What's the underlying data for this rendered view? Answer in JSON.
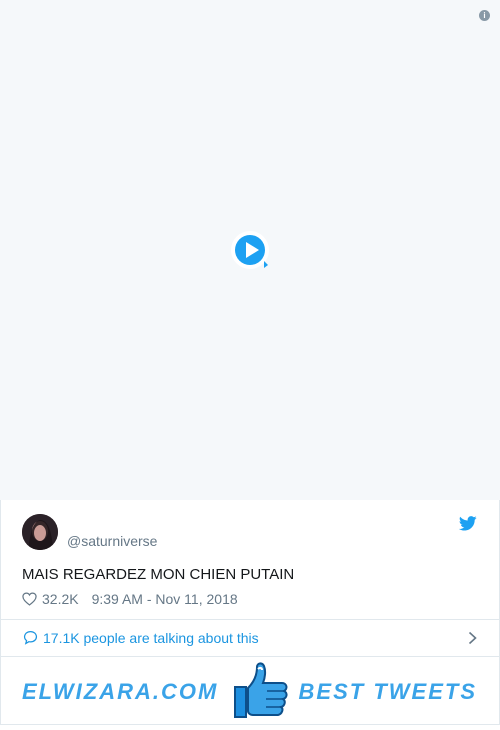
{
  "tweet": {
    "handle": "@saturniverse",
    "text": "MAIS REGARDEZ MON CHIEN PUTAIN",
    "likes": "32.2K",
    "timestamp": "9:39 AM - Nov 11, 2018",
    "talking": "17.1K people are talking about this"
  },
  "banner": {
    "brand": "ELWIZARA.COM",
    "tagline": "BEST TWEETS"
  },
  "icons": {
    "info": "info-icon",
    "play": "play-icon",
    "bird": "twitter-bird-icon",
    "heart": "heart-icon",
    "bubble": "speech-bubble-icon",
    "chevron": "chevron-right-icon",
    "thumb": "thumbs-up-icon"
  },
  "colors": {
    "accent": "#1da1f2",
    "link": "#1b95e0",
    "muted": "#657786",
    "brand": "#3aa3e8"
  }
}
